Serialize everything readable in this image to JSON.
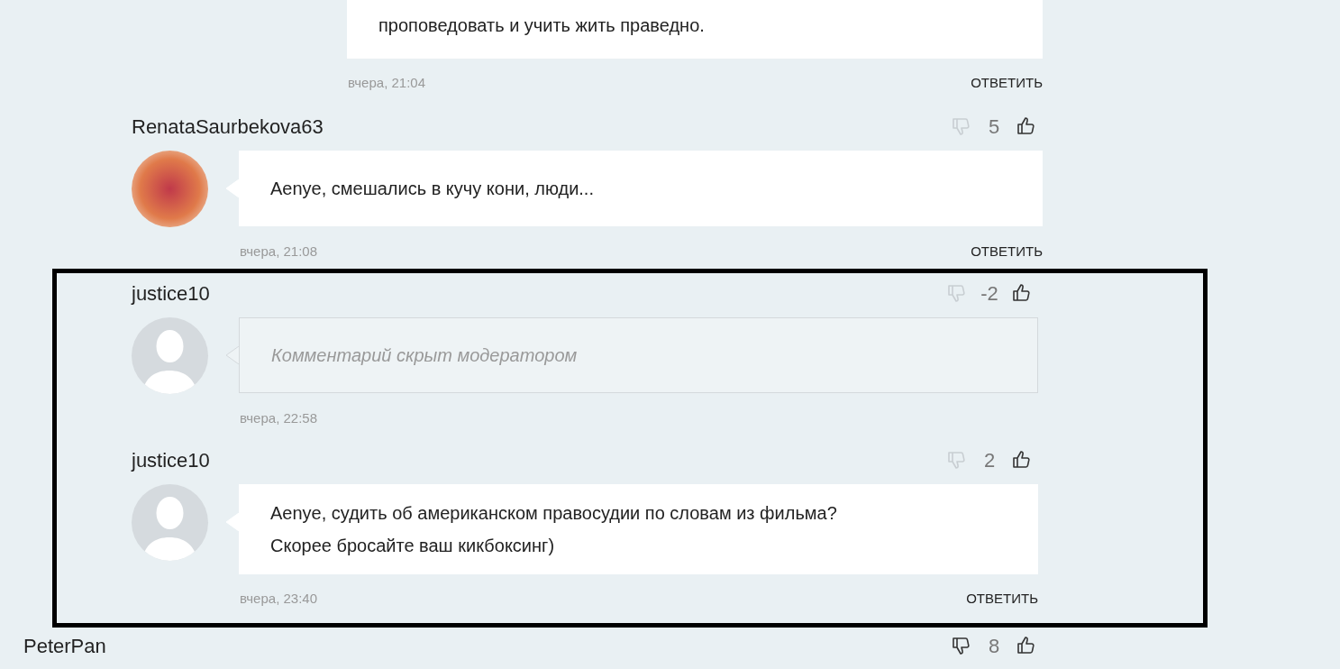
{
  "parent_comment": {
    "text": "проповедовать и учить жить праведно.",
    "date": "вчера, 21:04",
    "reply": "ОТВЕТИТЬ"
  },
  "replies": [
    {
      "user": "RenataSaurbekova63",
      "avatar_photo": true,
      "score": "5",
      "downvote_active": false,
      "kind": "comment",
      "text": [
        "Aenye, смешались в кучу кони, люди..."
      ],
      "date": "вчера, 21:08",
      "reply": "ОТВЕТИТЬ"
    }
  ],
  "highlighted_replies": [
    {
      "user": "justice10",
      "avatar_photo": false,
      "score": "-2",
      "downvote_active": false,
      "kind": "hidden",
      "text": [
        "Комментарий скрыт модератором"
      ],
      "date": "вчера, 22:58"
    },
    {
      "user": "justice10",
      "avatar_photo": false,
      "score": "2",
      "downvote_active": false,
      "kind": "comment",
      "text": [
        "Aenye, судить об американском правосудии по словам из фильма?",
        "Скорее бросайте ваш кикбоксинг)"
      ],
      "date": "вчера, 23:40",
      "reply": "ОТВЕТИТЬ"
    }
  ],
  "next_thread": {
    "user": "PeterPan",
    "score": "8",
    "downvote_active": true
  }
}
